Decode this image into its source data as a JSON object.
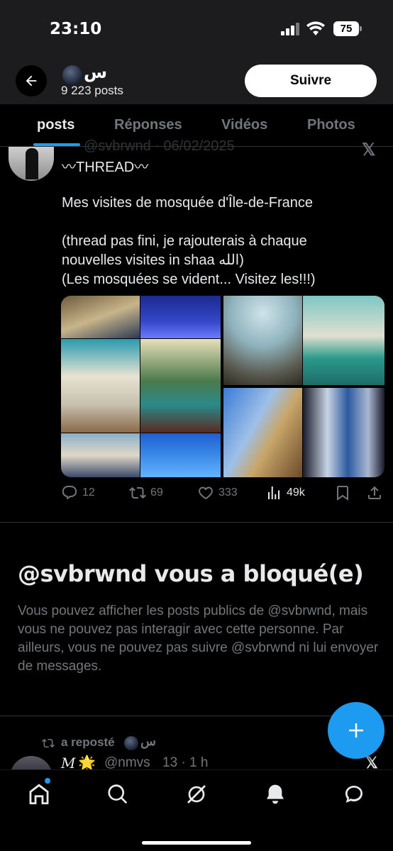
{
  "status_bar": {
    "time": "23:10",
    "battery": "75"
  },
  "header": {
    "display_name": "س",
    "post_count": "9 223 posts",
    "follow_label": "Suivre"
  },
  "tabs": [
    {
      "label": "posts",
      "active": true
    },
    {
      "label": "Réponses",
      "active": false
    },
    {
      "label": "Vidéos",
      "active": false
    },
    {
      "label": "Photos",
      "active": false
    }
  ],
  "tweet": {
    "header_partial": "@svbrwnd · 06/02/2025",
    "thread_label": "〰THREAD〰",
    "lines": [
      "Mes visites de mosquée d'Île-de-France",
      "(thread pas fini, je rajouterais à chaque",
      "nouvelles visites in shaa الله)",
      "(Les mosquées se vident... Visitez les!!!)"
    ],
    "actions": {
      "replies": "12",
      "reposts": "69",
      "likes": "333",
      "views": "49k"
    }
  },
  "blocked": {
    "title": "@svbrwnd vous a bloqué(e)",
    "text": "Vous pouvez afficher les posts publics de @svbrwnd, mais vous ne pouvez pas interagir avec cette personne. Par ailleurs, vous ne pouvez pas suivre @svbrwnd ni lui envoyer de messages."
  },
  "repost": {
    "label": "a reposté",
    "name": "س",
    "tweet_name": "M",
    "tweet_emoji": "🌟",
    "tweet_handle": "@nmvs",
    "tweet_time": "13 · 1 h"
  },
  "colors": {
    "accent": "#1d9bf0",
    "muted": "#71767b",
    "text": "#e7e9ea",
    "background": "#000000",
    "header_bg": "#1c1c1e"
  }
}
